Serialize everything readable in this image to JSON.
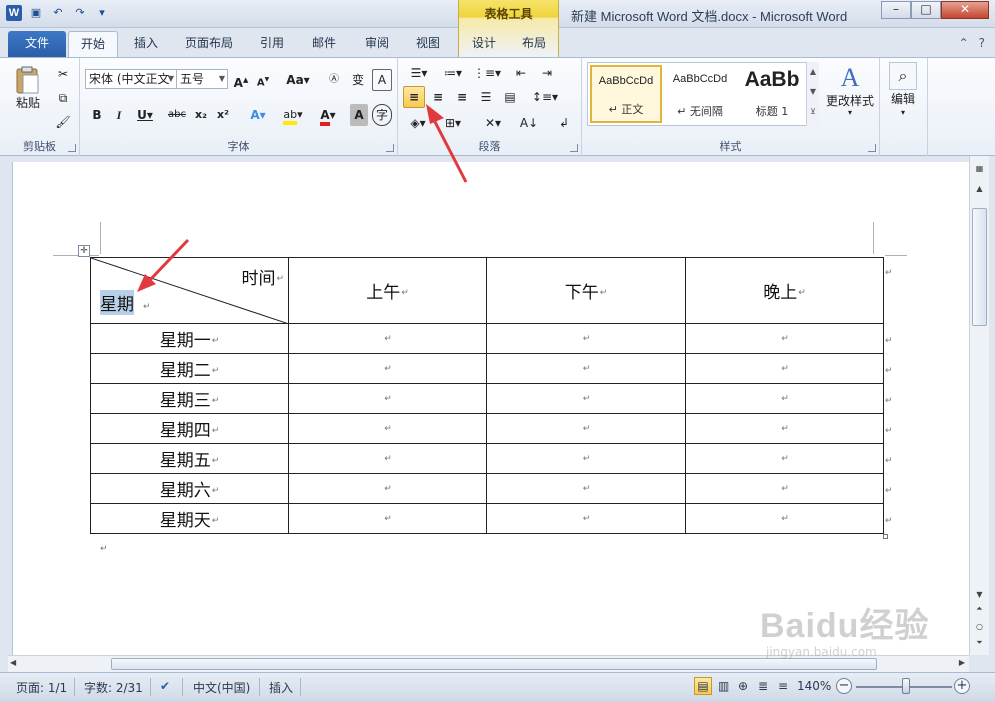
{
  "titlebar": {
    "title": "新建 Microsoft Word 文档.docx  -  Microsoft Word",
    "contextual_tools": "表格工具"
  },
  "tabs": [
    "文件",
    "开始",
    "插入",
    "页面布局",
    "引用",
    "邮件",
    "审阅",
    "视图",
    "设计",
    "布局"
  ],
  "ribbon": {
    "clipboard": {
      "paste": "粘贴",
      "label": "剪贴板"
    },
    "font": {
      "name": "宋体 (中文正文",
      "size": "五号",
      "label": "字体",
      "aa": "Aa"
    },
    "paragraph": {
      "label": "段落"
    },
    "styles": {
      "label": "样式",
      "items": [
        {
          "sample": "AaBbCcDd",
          "name": "↵ 正文"
        },
        {
          "sample": "AaBbCcDd",
          "name": "↵ 无间隔"
        },
        {
          "sample": "AaBb",
          "name": "标题 1"
        }
      ],
      "change": "更改样式"
    },
    "editing": {
      "label": "编辑"
    }
  },
  "table": {
    "header": {
      "time": "时间",
      "day": "星期",
      "cols": [
        "上午",
        "下午",
        "晚上"
      ]
    },
    "rows": [
      "星期一",
      "星期二",
      "星期三",
      "星期四",
      "星期五",
      "星期六",
      "星期天"
    ],
    "para_mark": "↵"
  },
  "statusbar": {
    "page": "页面: 1/1",
    "words": "字数: 2/31",
    "language": "中文(中国)",
    "mode": "插入",
    "zoom": "140%"
  },
  "watermark": {
    "brand": "Baidu经验",
    "url": "jingyan.baidu.com"
  },
  "colors": {
    "accent": "#2a5ea8",
    "selection": "#b8cfe9",
    "arrow": "#e0393e"
  }
}
